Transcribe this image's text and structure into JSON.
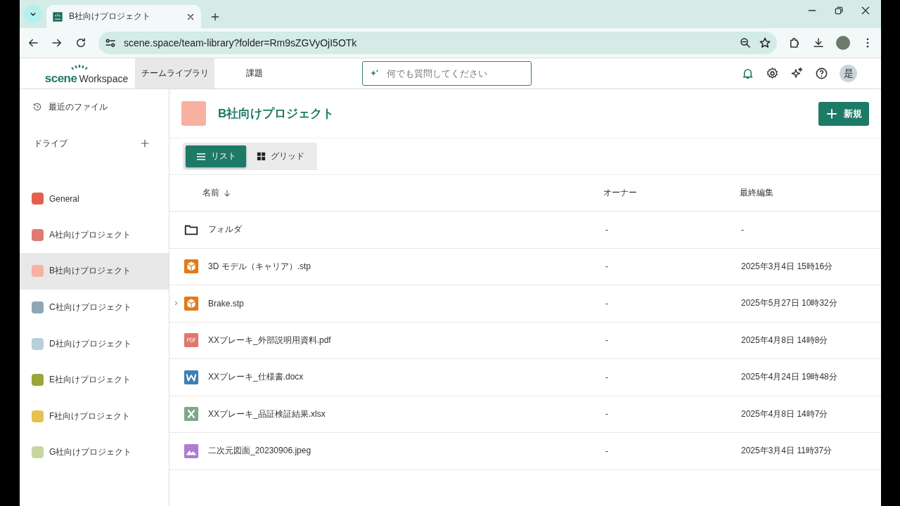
{
  "browser": {
    "tab_title": "B社向けプロジェクト",
    "url": "scene.space/team-library?folder=Rm9sZGVyOjI5OTk"
  },
  "header": {
    "logo_mark": "scene",
    "logo_text": "Workspace",
    "nav": [
      {
        "label": "チームライブラリ",
        "selected": true
      },
      {
        "label": "課題",
        "selected": false
      }
    ],
    "search": {
      "placeholder": "何でも質問してください"
    },
    "avatar": "是"
  },
  "sidebar": {
    "recent": "最近のファイル",
    "drive_label": "ドライブ",
    "drives": [
      {
        "name": "General",
        "color": "#e2604c",
        "selected": false
      },
      {
        "name": "A社向けプロジェクト",
        "color": "#df7b72",
        "selected": false
      },
      {
        "name": "B社向けプロジェクト",
        "color": "#f8b0a0",
        "selected": true
      },
      {
        "name": "C社向けプロジェクト",
        "color": "#8ea7b3",
        "selected": false
      },
      {
        "name": "D社向けプロジェクト",
        "color": "#b7cfd8",
        "selected": false
      },
      {
        "name": "E社向けプロジェクト",
        "color": "#9ba53a",
        "selected": false
      },
      {
        "name": "F社向けプロジェクト",
        "color": "#e5c24f",
        "selected": false
      },
      {
        "name": "G社向けプロジェクト",
        "color": "#c9d5a0",
        "selected": false
      }
    ]
  },
  "folder": {
    "title": "B社向けプロジェクト",
    "color": "#f8b0a0",
    "new_button": "新規"
  },
  "view_toggle": [
    {
      "label": "リスト",
      "kind": "list",
      "selected": true
    },
    {
      "label": "グリッド",
      "kind": "grid",
      "selected": false
    }
  ],
  "table": {
    "columns": [
      {
        "label": "名前",
        "sorted": true
      },
      {
        "label": "オーナー",
        "sorted": false
      },
      {
        "label": "最終編集",
        "sorted": false
      }
    ],
    "rows": [
      {
        "kind": "folder",
        "name": "フォルダ",
        "owner": "-",
        "edited": "-",
        "expandable": false
      },
      {
        "kind": "model",
        "name": "3D モデル（キャリア）.stp",
        "owner": "-",
        "edited": "2025年3月4日 15時16分",
        "expandable": false
      },
      {
        "kind": "model",
        "name": "Brake.stp",
        "owner": "-",
        "edited": "2025年5月27日 10時32分",
        "expandable": true
      },
      {
        "kind": "pdf",
        "name": "XXブレーキ_外部説明用資料.pdf",
        "owner": "-",
        "edited": "2025年4月8日 14時8分",
        "expandable": false
      },
      {
        "kind": "word",
        "name": "XXブレーキ_仕様書.docx",
        "owner": "-",
        "edited": "2025年4月24日 19時48分",
        "expandable": false
      },
      {
        "kind": "excel",
        "name": "XXブレーキ_品証検証結果.xlsx",
        "owner": "-",
        "edited": "2025年4月8日 14時7分",
        "expandable": false
      },
      {
        "kind": "image",
        "name": "二次元図面_20230906.jpeg",
        "owner": "-",
        "edited": "2025年3月4日 11時37分",
        "expandable": false
      }
    ]
  }
}
